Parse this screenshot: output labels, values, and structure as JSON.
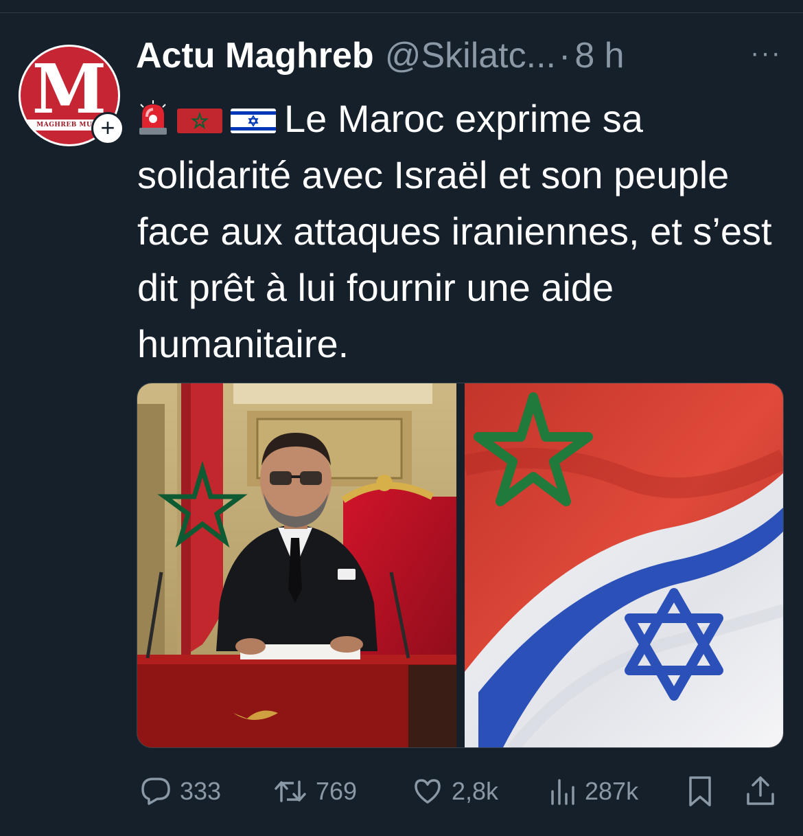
{
  "tweet": {
    "avatar": {
      "letter": "M",
      "band_text": "MAGHREB MUSE"
    },
    "display_name": "Actu Maghreb",
    "handle": "@Skilatc...",
    "separator": "·",
    "time": "8 h",
    "more_label": "···",
    "text": "Le Maroc exprime sa solidarité avec Israël et son peuple face aux attaques iraniennes, et s’est dit prêt à lui fournir une aide humanitaire.",
    "emojis": [
      "rotating-light-emoji",
      "morocco-flag-emoji",
      "israel-flag-emoji"
    ]
  },
  "media": {
    "left": {
      "description": "speech-podium-photo"
    },
    "right": {
      "description": "morocco-israel-flags-photo"
    }
  },
  "actions": {
    "replies": "333",
    "reposts": "769",
    "likes": "2,8k",
    "views": "287k"
  },
  "colors": {
    "background": "#15202b",
    "muted": "#8b98a5",
    "brand_red": "#c62633"
  }
}
